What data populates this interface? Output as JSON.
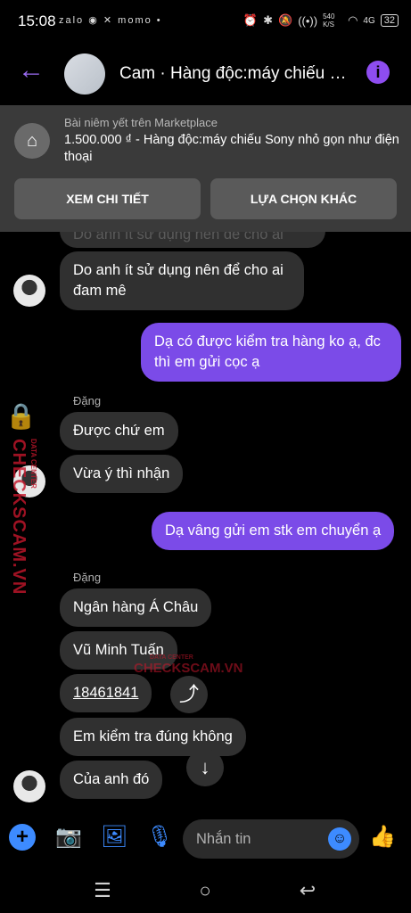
{
  "status": {
    "time": "15:08",
    "left_icons": "zalo ◉ ✕ momo •",
    "speed": "540 K/S",
    "network": "4G",
    "battery": "32"
  },
  "header": {
    "title": "Cam · Hàng độc:máy chiếu Son..."
  },
  "marketplace": {
    "subtitle": "Bài niêm yết trên Marketplace",
    "listing": "1.500.000 ₫ - Hàng độc:máy chiếu Sony nhỏ gọn như điện thoại",
    "btn_details": "XEM CHI TIẾT",
    "btn_other": "LỰA CHỌN KHÁC"
  },
  "messages": {
    "m0": "Do anh ít sử dụng nên để cho ai",
    "m1": "Do anh ít sử dụng nên để cho ai đam mê",
    "m2": "Dạ có được kiểm tra hàng ko ạ, đc thì em gửi cọc ạ",
    "sender1": "Đặng",
    "m3": "Được chứ em",
    "m4": "Vừa ý thì nhận",
    "m5": "Dạ vâng gửi em stk em chuyển ạ",
    "sender2": "Đặng",
    "m6": "Ngân hàng Á Châu",
    "m7": "Vũ Minh Tuấn",
    "m8": "18461841",
    "m9": "Em kiểm tra đúng không",
    "m10": "Của anh đó"
  },
  "watermark": {
    "side": "CHECKSCAM.VN",
    "side_small": "DATA CENTER",
    "center_small": "DATA CENTER",
    "center": "CHECKSCAM.VN"
  },
  "composer": {
    "placeholder": "Nhắn tin"
  },
  "colors": {
    "accent": "#7b4be8",
    "messenger_blue": "#3d8bff",
    "bubble_in": "#303030"
  }
}
